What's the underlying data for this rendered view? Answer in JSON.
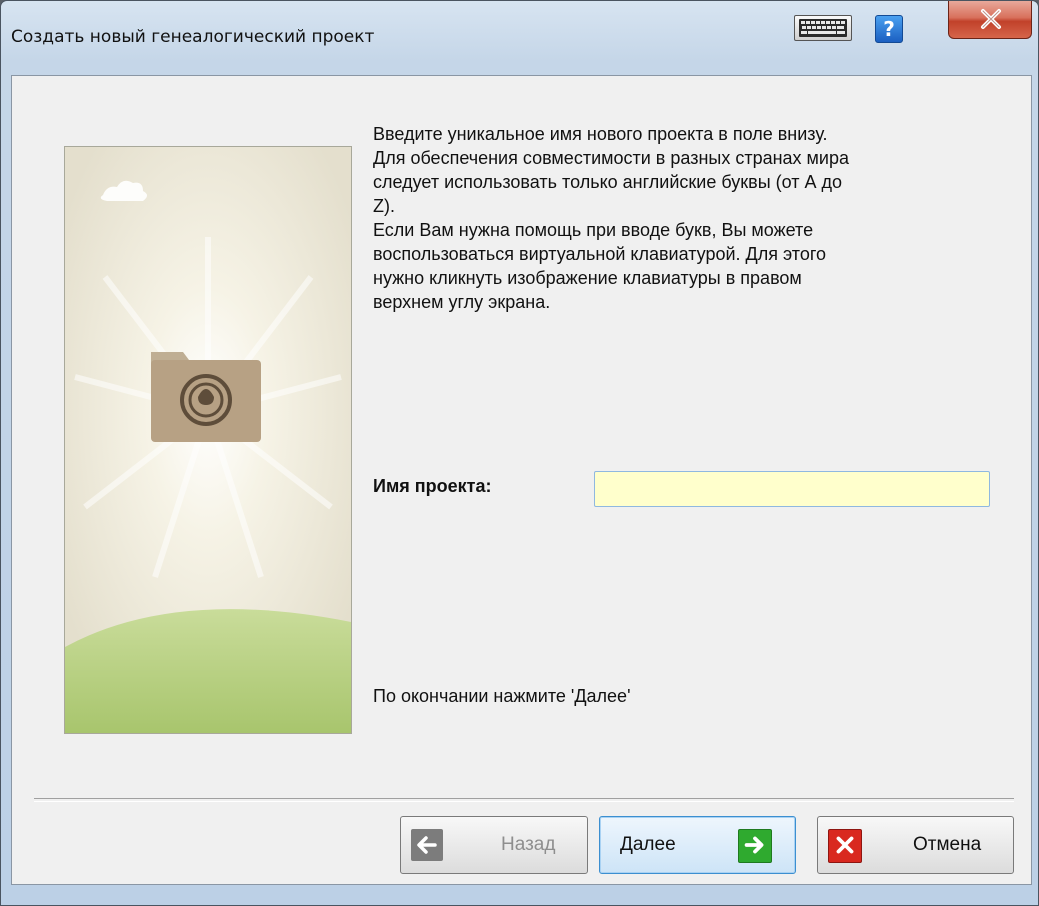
{
  "window": {
    "title": "Создать новый генеалогический проект",
    "help_label": "?",
    "close_label": "x"
  },
  "content": {
    "description": "Введите уникальное имя нового проекта в поле внизу.\nДля обеспечения совместимости в разных странах мира\nследует использовать только английские буквы (от А до\nZ).\nЕсли Вам нужна помощь при вводе букв, Вы можете\nвоспользоваться виртуальной клавиатурой. Для этого\nнужно кликнуть изображение клавиатуры в правом\nверхнем углу экрана.",
    "field_label": "Имя проекта:",
    "field_value": "",
    "footer_note": "По окончании нажмите 'Далее'"
  },
  "buttons": {
    "back": "Назад",
    "next": "Далее",
    "cancel": "Отмена"
  },
  "icons": {
    "keyboard": "keyboard-icon",
    "help": "help-icon",
    "close": "close-icon",
    "folder": "folder-tree-icon",
    "back": "arrow-left-icon",
    "next": "arrow-right-icon",
    "cancel": "cross-icon"
  },
  "colors": {
    "input_background": "#ffffcc",
    "next_icon": "#2faa2f",
    "cancel_icon": "#d9281f",
    "close_button": "#c1412a"
  }
}
